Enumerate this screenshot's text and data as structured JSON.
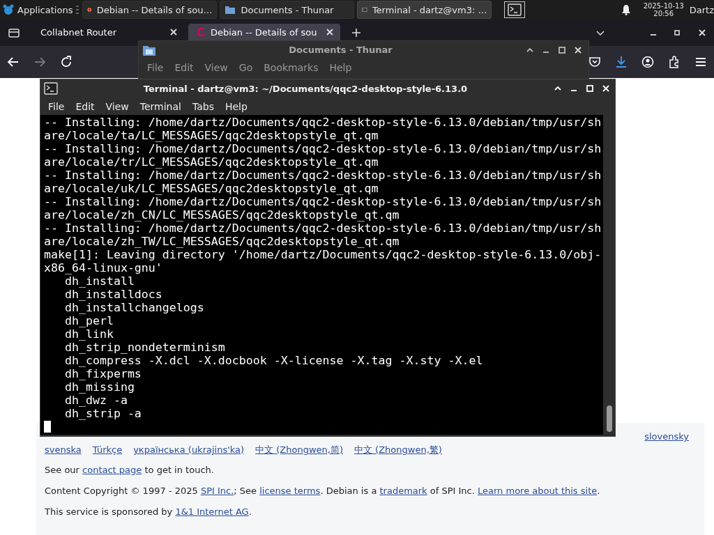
{
  "taskbar": {
    "apps_menu": "Applications",
    "tasks": [
      {
        "title": "Debian -- Details of sou…",
        "kind": "browser",
        "selected": false
      },
      {
        "title": "Documents - Thunar",
        "kind": "files",
        "selected": false
      },
      {
        "title": "Terminal - dartz@vm3: …",
        "kind": "terminal",
        "selected": true
      }
    ],
    "clock": {
      "date": "2025-10-13",
      "time": "20:56"
    },
    "user": "Dartz"
  },
  "browser": {
    "tabs": [
      {
        "title": "Collabnet Router",
        "selected": false
      },
      {
        "title": "Debian -- Details of sou",
        "selected": true
      }
    ],
    "footer": {
      "languages_row_1": [
        "slovensky"
      ],
      "languages_row_2": [
        "svenska",
        "Türkçe",
        "українська (ukrajins'ka)",
        "中文 (Zhongwen,简)",
        "中文 (Zhongwen,繁)"
      ],
      "paragraphs": [
        [
          {
            "kind": "text",
            "text": "See our "
          },
          {
            "kind": "link",
            "text": "contact page"
          },
          {
            "kind": "text",
            "text": " to get in touch."
          }
        ],
        [
          {
            "kind": "text",
            "text": "Content Copyright © 1997 - 2025 "
          },
          {
            "kind": "link",
            "text": "SPI Inc."
          },
          {
            "kind": "text",
            "text": "; See "
          },
          {
            "kind": "link",
            "text": "license terms"
          },
          {
            "kind": "text",
            "text": ". Debian is a "
          },
          {
            "kind": "link",
            "text": "trademark"
          },
          {
            "kind": "text",
            "text": " of SPI Inc. "
          },
          {
            "kind": "link",
            "text": "Learn more about this site"
          },
          {
            "kind": "text",
            "text": "."
          }
        ],
        [
          {
            "kind": "text",
            "text": "This service is sponsored by "
          },
          {
            "kind": "link",
            "text": "1&1 Internet AG"
          },
          {
            "kind": "text",
            "text": "."
          }
        ]
      ]
    }
  },
  "thunar": {
    "title": "Documents - Thunar",
    "menu": [
      "File",
      "Edit",
      "View",
      "Go",
      "Bookmarks",
      "Help"
    ]
  },
  "terminal": {
    "title": "Terminal - dartz@vm3: ~/Documents/qqc2-desktop-style-6.13.0",
    "menu": [
      "File",
      "Edit",
      "View",
      "Terminal",
      "Tabs",
      "Help"
    ],
    "lines": [
      "-- Installing: /home/dartz/Documents/qqc2-desktop-style-6.13.0/debian/tmp/usr/sh",
      "are/locale/ta/LC_MESSAGES/qqc2desktopstyle_qt.qm",
      "-- Installing: /home/dartz/Documents/qqc2-desktop-style-6.13.0/debian/tmp/usr/sh",
      "are/locale/tr/LC_MESSAGES/qqc2desktopstyle_qt.qm",
      "-- Installing: /home/dartz/Documents/qqc2-desktop-style-6.13.0/debian/tmp/usr/sh",
      "are/locale/uk/LC_MESSAGES/qqc2desktopstyle_qt.qm",
      "-- Installing: /home/dartz/Documents/qqc2-desktop-style-6.13.0/debian/tmp/usr/sh",
      "are/locale/zh_CN/LC_MESSAGES/qqc2desktopstyle_qt.qm",
      "-- Installing: /home/dartz/Documents/qqc2-desktop-style-6.13.0/debian/tmp/usr/sh",
      "are/locale/zh_TW/LC_MESSAGES/qqc2desktopstyle_qt.qm",
      "make[1]: Leaving directory '/home/dartz/Documents/qqc2-desktop-style-6.13.0/obj-",
      "x86_64-linux-gnu'",
      "   dh_install",
      "   dh_installdocs",
      "   dh_installchangelogs",
      "   dh_perl",
      "   dh_link",
      "   dh_strip_nondeterminism",
      "   dh_compress -X.dcl -X.docbook -X-license -X.tag -X.sty -X.el",
      "   dh_fixperms",
      "   dh_missing",
      "   dh_dwz -a",
      "   dh_strip -a"
    ]
  }
}
